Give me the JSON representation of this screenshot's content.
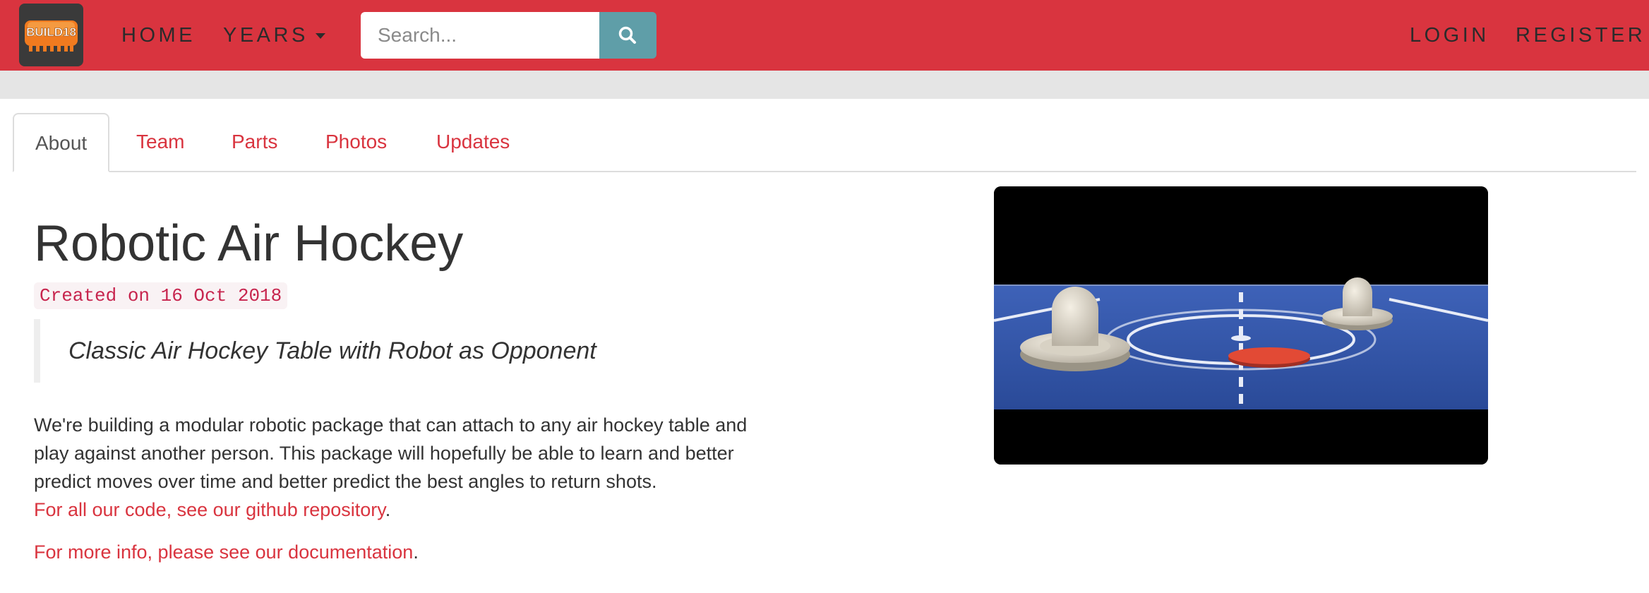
{
  "header": {
    "logo_text": "BUILD18",
    "nav": {
      "home": "HOME",
      "years": "YEARS",
      "login": "LOGIN",
      "register": "REGISTER"
    },
    "search": {
      "placeholder": "Search...",
      "value": ""
    },
    "colors": {
      "brand": "#d9343f",
      "search_button": "#5f9ea8"
    }
  },
  "tabs": [
    {
      "label": "About",
      "active": true
    },
    {
      "label": "Team",
      "active": false
    },
    {
      "label": "Parts",
      "active": false
    },
    {
      "label": "Photos",
      "active": false
    },
    {
      "label": "Updates",
      "active": false
    }
  ],
  "project": {
    "title": "Robotic Air Hockey",
    "created": "Created on 16 Oct 2018",
    "tagline": "Classic Air Hockey Table with Robot as Opponent",
    "description": "We're building a modular robotic package that can attach to any air hockey table and play against another person. This package will hopefully be able to learn and better predict moves over time and better predict the best angles to return shots.",
    "code_link": "For all our code, see our github repository",
    "docs_link": "For more info, please see our documentation",
    "period": "."
  },
  "icons": {
    "search": "search-icon"
  }
}
